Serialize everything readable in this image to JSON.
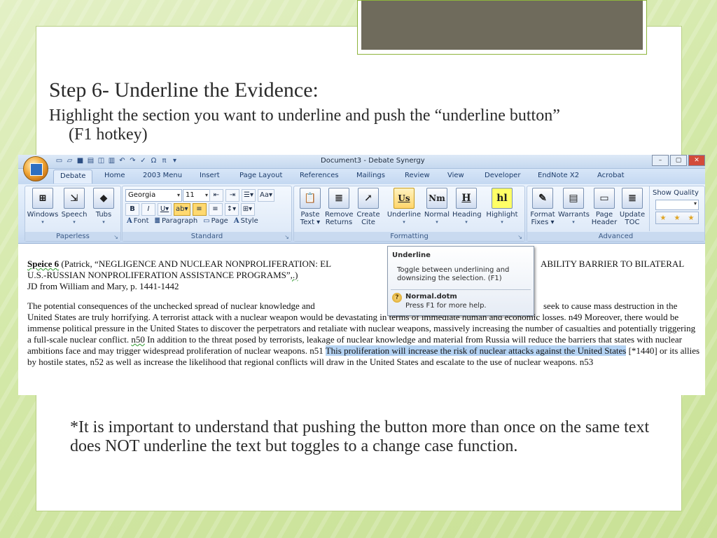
{
  "slide": {
    "title": "Step 6- Underline the Evidence:",
    "body_line1": "Highlight the section you want to underline and push the “underline button”",
    "body_line2": "(F1 hotkey)",
    "note": "*It is important to understand that pushing the button more than once on the same text does NOT underline the text but toggles to a change case function."
  },
  "word": {
    "window_title": "Document3 - Debate Synergy",
    "tabs": [
      "Debate",
      "Home",
      "2003 Menu",
      "Insert",
      "Page Layout",
      "References",
      "Mailings",
      "Review",
      "View",
      "Developer",
      "EndNote X2",
      "Acrobat"
    ],
    "groups": {
      "paperless": {
        "label": "Paperless",
        "buttons": [
          {
            "line1": "Windows",
            "line2": "▾"
          },
          {
            "line1": "Speech",
            "line2": "▾"
          },
          {
            "line1": "Tubs",
            "line2": "▾"
          }
        ]
      },
      "standard": {
        "label": "Standard",
        "font_name": "Georgia",
        "font_size": "11",
        "links": [
          "Font",
          "Paragraph",
          "Page",
          "Style"
        ]
      },
      "formatting": {
        "label": "Formatting",
        "buttons": [
          {
            "line1": "Paste",
            "line2": "Text ▾",
            "glyph": "📋"
          },
          {
            "line1": "Remove",
            "line2": "Returns",
            "glyph": "≣"
          },
          {
            "line1": "Create",
            "line2": "Cite",
            "glyph": "↗"
          },
          {
            "line1": "Underline",
            "line2": "▾",
            "glyph": "Us"
          },
          {
            "line1": "Normal",
            "line2": "▾",
            "glyph": "Nm"
          },
          {
            "line1": "Heading",
            "line2": "▾",
            "glyph": "H"
          },
          {
            "line1": "Highlight",
            "line2": "▾",
            "glyph": "hl"
          }
        ]
      },
      "advanced": {
        "label": "Advanced",
        "buttons": [
          {
            "line1": "Format",
            "line2": "Fixes ▾"
          },
          {
            "line1": "Warrants",
            "line2": "▾"
          },
          {
            "line1": "Page",
            "line2": "Header"
          },
          {
            "line1": "Update",
            "line2": "TOC"
          }
        ],
        "show_quality": "Show Quality"
      }
    },
    "tooltip": {
      "title": "Underline",
      "description": "Toggle between underlining and downsizing the selection. (F1)",
      "template": "Normal.dotm",
      "help": "Press F1 for more help."
    },
    "document": {
      "cite_tag": "Speice 6",
      "cite_rest": " (Patrick, “NEGLIGENCE AND NUCLEAR NONPROLIFERATION: EL",
      "cite_hidden_gap": "",
      "cite_right": "ABILITY BARRIER TO BILATERAL",
      "cite_line2": "U.S.-RUSSIAN NONPROLIFERATION ASSISTANCE PROGRAMS”",
      "cite_line2_end": ",.)",
      "cite_line3": "JD from William and Mary, p. 1441-1442",
      "p_part1": "The potential consequences of the unchecked spread of nuclear knowledge and",
      "p_part1_right": "seek to cause mass destruction in the",
      "p_part2": "United States are truly horrifying. A terrorist attack with a nuclear weapon would be devastating in terms of immediate human and economic losses. n49 Moreover, there would be immense political pressure in the United States to discover the perpetrators and retaliate with nuclear weapons, massively increasing the number of casualties and potentially triggering a full-scale nuclear conflict.",
      "n50": "n50",
      "p_part3": " In addition to the threat posed by terrorists, leakage of nuclear knowledge and material from Russia will reduce the barriers that states with nuclear ambitions face and may trigger widespread proliferation of nuclear weapons. n51 ",
      "highlighted": "This proliferation will increase the risk of nuclear attacks against the United States",
      "p_part4": " [*1440] or its allies by hostile states, n52 as well as increase the likelihood that regional conflicts will draw in the United States and escalate to the use of nuclear weapons. n53"
    }
  },
  "colors": {
    "highlight": "#b5d3f3",
    "slide_green": "#c9e196",
    "ribbon_blue": "#d2e2f6"
  }
}
